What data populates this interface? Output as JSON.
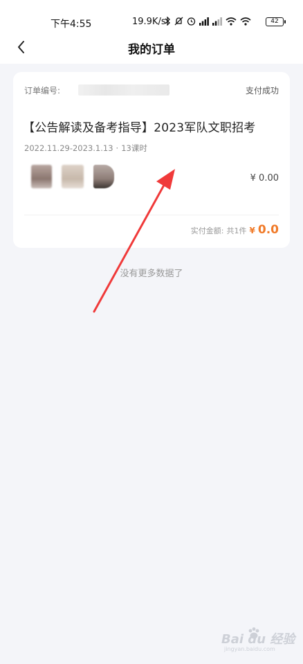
{
  "status_bar": {
    "time": "下午4:55",
    "network_speed": "19.9K/s",
    "battery": "42",
    "icons": [
      "bluetooth-icon",
      "mute-icon",
      "alarm-icon",
      "signal-icon",
      "signal-icon",
      "wifi-icon",
      "wifi-icon",
      "battery-icon"
    ]
  },
  "header": {
    "back_icon": "chevron-left-icon",
    "title": "我的订单"
  },
  "orders": [
    {
      "order_no_label": "订单编号:",
      "status": "支付成功",
      "title": "【公告解读及备考指导】2023军队文职招考",
      "date_range": "2022.11.29-2023.1.13",
      "separator": "·",
      "lessons": "13课时",
      "price": "¥ 0.00",
      "paid_label": "实付金额:",
      "item_count": "共1件",
      "currency": "¥",
      "paid_amount": "0.0"
    }
  ],
  "list_footer": "没有更多数据了",
  "annotation": {
    "arrow_color": "#f03a3a"
  },
  "watermark": {
    "brand": "Bai du 经验",
    "site": "jingyan.baidu.com"
  },
  "colors": {
    "accent": "#f07a28",
    "background": "#f4f5f9"
  }
}
